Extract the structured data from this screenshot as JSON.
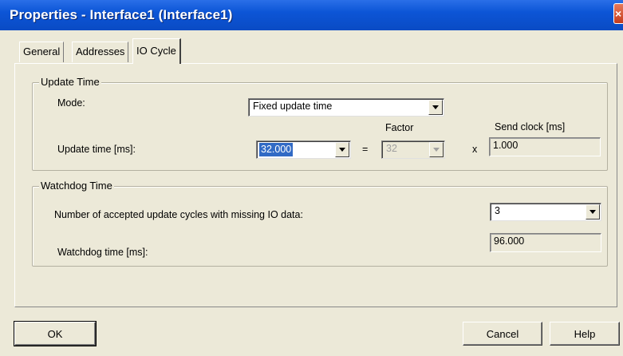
{
  "window": {
    "title": "Properties - Interface1 (Interface1)",
    "close_glyph": "×"
  },
  "tabs": [
    {
      "label": "General"
    },
    {
      "label": "Addresses"
    },
    {
      "label": "IO Cycle",
      "active": true
    }
  ],
  "update_time": {
    "group_label": "Update Time",
    "mode_label": "Mode:",
    "mode_value": "Fixed update time",
    "factor_label": "Factor",
    "send_clock_label": "Send clock [ms]",
    "update_time_label": "Update time [ms]:",
    "update_time_value": "32.000",
    "equals_sign": "=",
    "factor_value": "32",
    "multiply_sign": "x",
    "send_clock_value": "1.000"
  },
  "watchdog": {
    "group_label": "Watchdog Time",
    "cycles_label": "Number of accepted update cycles with missing IO data:",
    "cycles_value": "3",
    "watchdog_time_label": "Watchdog time [ms]:",
    "watchdog_time_value": "96.000"
  },
  "buttons": {
    "ok": "OK",
    "cancel": "Cancel",
    "help": "Help"
  }
}
